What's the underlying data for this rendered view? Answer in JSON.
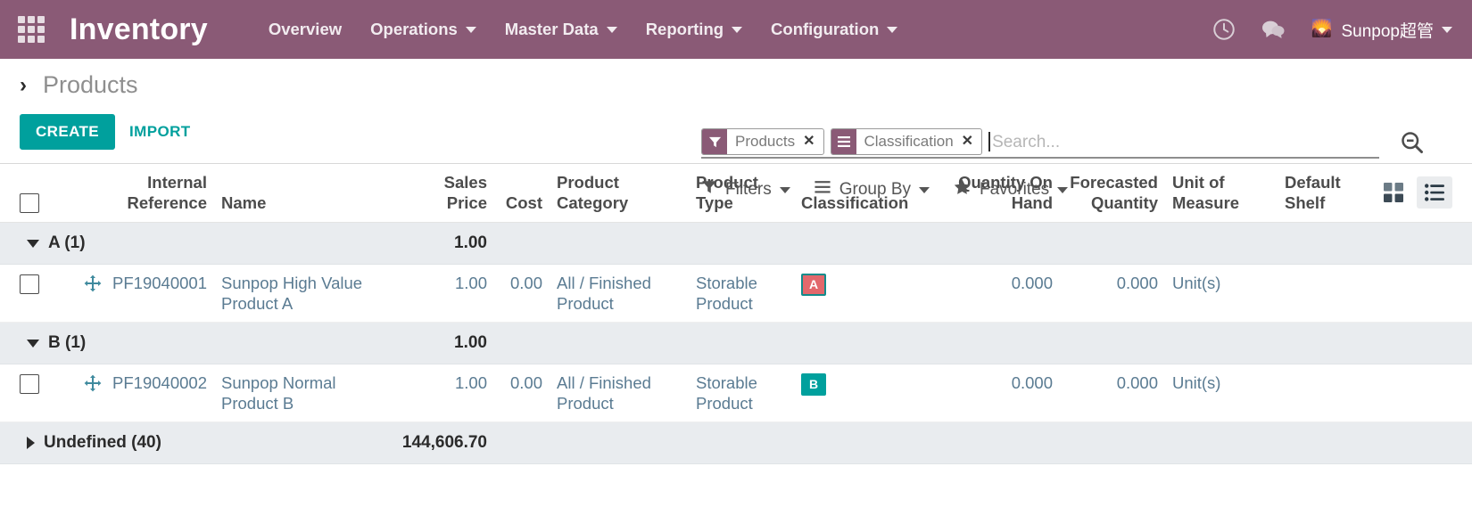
{
  "navbar": {
    "apps_icon": "apps-grid-icon",
    "brand": "Inventory",
    "menu": [
      {
        "label": "Overview",
        "has_caret": false
      },
      {
        "label": "Operations",
        "has_caret": true
      },
      {
        "label": "Master Data",
        "has_caret": true
      },
      {
        "label": "Reporting",
        "has_caret": true
      },
      {
        "label": "Configuration",
        "has_caret": true
      }
    ],
    "activity_icon": "clock-icon",
    "messaging_icon": "chat-bubbles-icon",
    "user": {
      "avatar_glyph": "🌄",
      "name": "Sunpop超管"
    },
    "colors": {
      "navbar_bg": "#8a5a76",
      "accent": "#00a09d"
    }
  },
  "control_panel": {
    "breadcrumb_arrow": "chevron-right-icon",
    "breadcrumb_title": "Products",
    "create_label": "CREATE",
    "import_label": "IMPORT"
  },
  "search": {
    "facets": [
      {
        "icon": "filter-funnel-icon",
        "label": "Products",
        "remove": "✕"
      },
      {
        "icon": "group-by-list-icon",
        "label": "Classification",
        "remove": "✕"
      }
    ],
    "value": "",
    "placeholder": "Search...",
    "toggle_icon": "search-minus-icon"
  },
  "filter_menus": [
    {
      "icon": "filter-funnel-icon",
      "label": "Filters",
      "has_caret": true
    },
    {
      "icon": "group-by-list-icon",
      "label": "Group By",
      "has_caret": true
    },
    {
      "icon": "star-icon",
      "label": "Favorites",
      "has_caret": true
    }
  ],
  "view_switcher": {
    "kanban": {
      "icon": "kanban-grid-icon",
      "active": false
    },
    "list": {
      "icon": "list-view-icon",
      "active": true
    }
  },
  "table": {
    "columns": [
      {
        "key": "select",
        "line1": "",
        "line2": ""
      },
      {
        "key": "internal_ref",
        "line1": "Internal",
        "line2": "Reference"
      },
      {
        "key": "name",
        "line1": "",
        "line2": "Name"
      },
      {
        "key": "sales_price",
        "line1": "Sales",
        "line2": "Price"
      },
      {
        "key": "cost",
        "line1": "",
        "line2": "Cost"
      },
      {
        "key": "product_cat",
        "line1": "Product",
        "line2": "Category"
      },
      {
        "key": "product_type",
        "line1": "Product",
        "line2": "Type"
      },
      {
        "key": "classification",
        "line1": "",
        "line2": "Classification"
      },
      {
        "key": "qty_on_hand",
        "line1": "Quantity On",
        "line2": "Hand"
      },
      {
        "key": "forecasted",
        "line1": "Forecasted",
        "line2": "Quantity"
      },
      {
        "key": "uom",
        "line1": "Unit of",
        "line2": "Measure"
      },
      {
        "key": "default_shelf",
        "line1": "Default",
        "line2": "Shelf"
      }
    ],
    "groups": [
      {
        "label": "A (1)",
        "expanded": true,
        "sum_sales_price": "1.00",
        "rows": [
          {
            "internal_ref": "PF19040001",
            "name": "Sunpop High Value Product A",
            "sales_price": "1.00",
            "cost": "0.00",
            "product_cat": "All / Finished Product",
            "product_type": "Storable Product",
            "classification": "A",
            "classification_style": "badge-a",
            "qty_on_hand": "0.000",
            "forecasted": "0.000",
            "uom": "Unit(s)",
            "default_shelf": ""
          }
        ]
      },
      {
        "label": "B (1)",
        "expanded": true,
        "sum_sales_price": "1.00",
        "rows": [
          {
            "internal_ref": "PF19040002",
            "name": "Sunpop Normal Product B",
            "sales_price": "1.00",
            "cost": "0.00",
            "product_cat": "All / Finished Product",
            "product_type": "Storable Product",
            "classification": "B",
            "classification_style": "badge-b",
            "qty_on_hand": "0.000",
            "forecasted": "0.000",
            "uom": "Unit(s)",
            "default_shelf": ""
          }
        ]
      },
      {
        "label": "Undefined (40)",
        "expanded": false,
        "sum_sales_price": "144,606.70",
        "rows": []
      }
    ]
  }
}
